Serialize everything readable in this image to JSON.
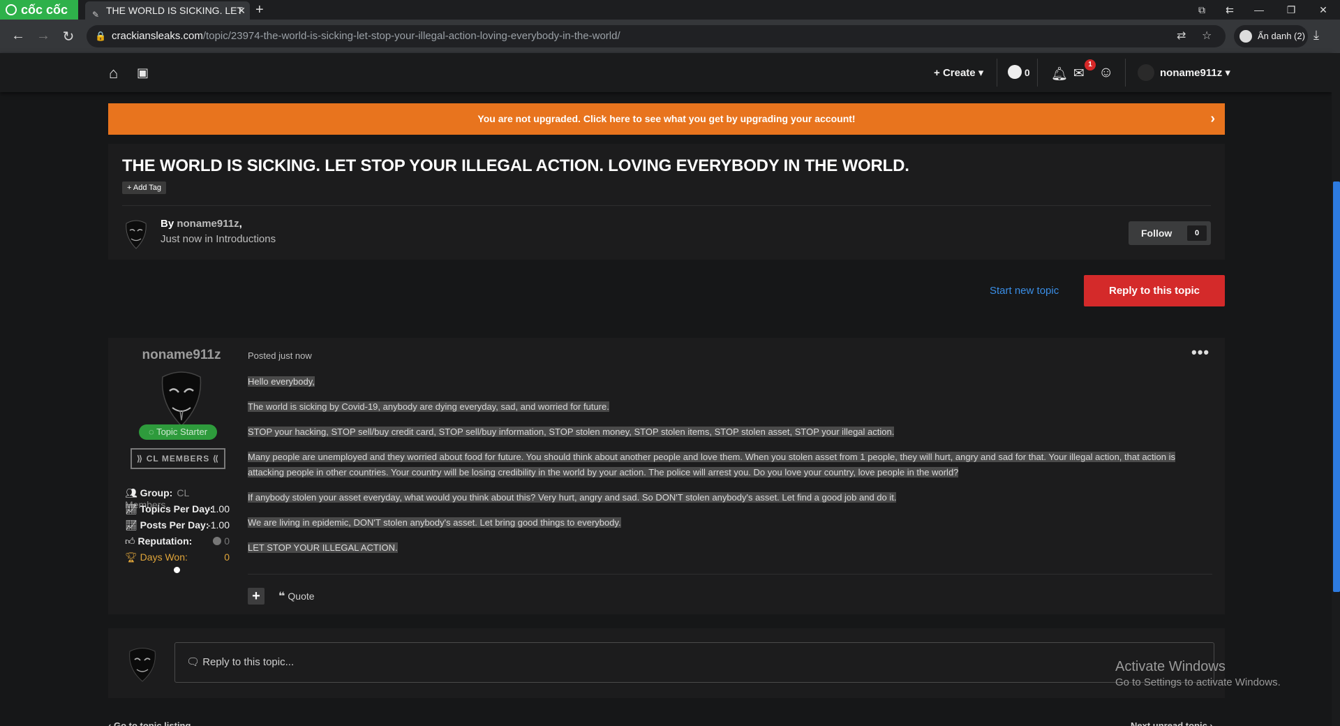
{
  "browser": {
    "logo": "cốc cốc",
    "tab_title": "THE WORLD IS SICKING. LET",
    "url_host": "crackiansleaks.com",
    "url_path": "/topic/23974-the-world-is-sicking-let-stop-your-illegal-action-loving-everybody-in-the-world/",
    "incognito_label": "Ẩn danh (2)"
  },
  "header": {
    "create_label": "Create",
    "points_value": "0",
    "messages_badge": "1",
    "username": "noname911z"
  },
  "banner": {
    "text": "You are not upgraded. Click here to see what you get by upgrading your account!"
  },
  "topic": {
    "title": "THE WORLD IS SICKING. LET STOP YOUR ILLEGAL ACTION. LOVING EVERYBODY IN THE WORLD.",
    "add_tag_label": "Add Tag",
    "by_label": "By",
    "author": "noname911z",
    "when": "Just now in Introductions",
    "follow_label": "Follow",
    "follow_count": "0"
  },
  "actions": {
    "start_new": "Start new topic",
    "reply": "Reply to this topic"
  },
  "post": {
    "author": "noname911z",
    "topic_starter": "Topic Starter",
    "members_badge": "CL MEMBERS",
    "stats": {
      "group_label": "Group:",
      "group_value": "CL Members",
      "topics_label": "Topics Per Day:",
      "topics_value": "-1.00",
      "posts_label": "Posts Per Day:",
      "posts_value": "-1.00",
      "rep_label": "Reputation:",
      "rep_value": "0",
      "won_label": "Days Won:",
      "won_value": "0"
    },
    "posted": "Posted just now",
    "paragraphs": [
      "Hello everybody,",
      "The world is sicking by Covid-19, anybody are dying everyday, sad, and worried for future.",
      "STOP your hacking, STOP sell/buy credit card, STOP sell/buy information, STOP stolen money, STOP stolen items, STOP stolen asset, STOP your illegal action.",
      "Many people are unemployed and they worried about food for future. You should think about another people and love them. When you stolen asset from 1 people, they will hurt, angry and sad for that. Your illegal action, that action is attacking people in other countries. Your country will be losing credibility in the world by your action. The police will arrest you. Do you love your country, love people in the world?",
      "If anybody stolen your asset everyday, what would you think about this? Very hurt, angry and sad. So DON'T stolen anybody's asset. Let find a good job and do it.",
      "We are living in epidemic, DON'T stolen anybody's asset. Let bring good things to everybody.",
      "LET STOP YOUR ILLEGAL ACTION."
    ],
    "quote_label": "Quote"
  },
  "reply_box": {
    "placeholder": "Reply to this topic..."
  },
  "windows": {
    "line1": "Activate Windows",
    "line2": "Go to Settings to activate Windows."
  },
  "pager": {
    "prev": "Go to topic listing",
    "next": "Next unread topic"
  },
  "colors": {
    "accent_orange": "#e8741e",
    "reply_red": "#d42a2a",
    "link_blue": "#3a8ee6",
    "starter_green": "#2e9b3c"
  }
}
